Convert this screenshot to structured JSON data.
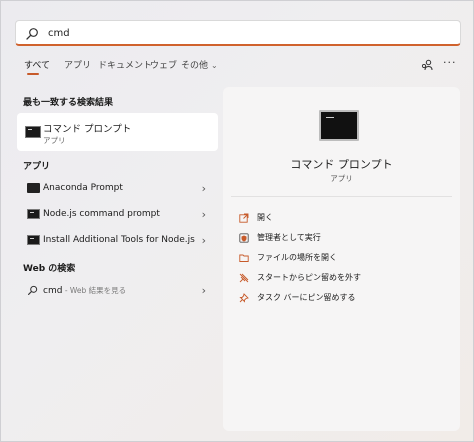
{
  "search": {
    "value": "cmd",
    "icon": "search-icon"
  },
  "tabs": [
    {
      "label": "すべて"
    },
    {
      "label": "アプリ"
    },
    {
      "label": "ドキュメント"
    },
    {
      "label": "ウェブ"
    },
    {
      "label": "その他"
    }
  ],
  "colors": {
    "accent": "#c75a2a"
  },
  "best_match": {
    "heading": "最も一致する検索結果",
    "title": "コマンド プロンプト",
    "subtitle": "アプリ"
  },
  "apps": {
    "heading": "アプリ",
    "items": [
      {
        "label": "Anaconda Prompt"
      },
      {
        "label": "Node.js command prompt"
      },
      {
        "label": "Install Additional Tools for Node.js"
      }
    ]
  },
  "web": {
    "heading": "Web の検索",
    "query": "cmd",
    "suffix": " - Web 結果を見る"
  },
  "detail": {
    "title": "コマンド プロンプト",
    "subtitle": "アプリ",
    "actions": [
      {
        "label": "開く",
        "icon": "open-external-icon"
      },
      {
        "label": "管理者として実行",
        "icon": "admin-shield-icon"
      },
      {
        "label": "ファイルの場所を開く",
        "icon": "folder-icon"
      },
      {
        "label": "スタートからピン留めを外す",
        "icon": "unpin-icon"
      },
      {
        "label": "タスク バーにピン留めする",
        "icon": "pin-icon"
      }
    ]
  }
}
